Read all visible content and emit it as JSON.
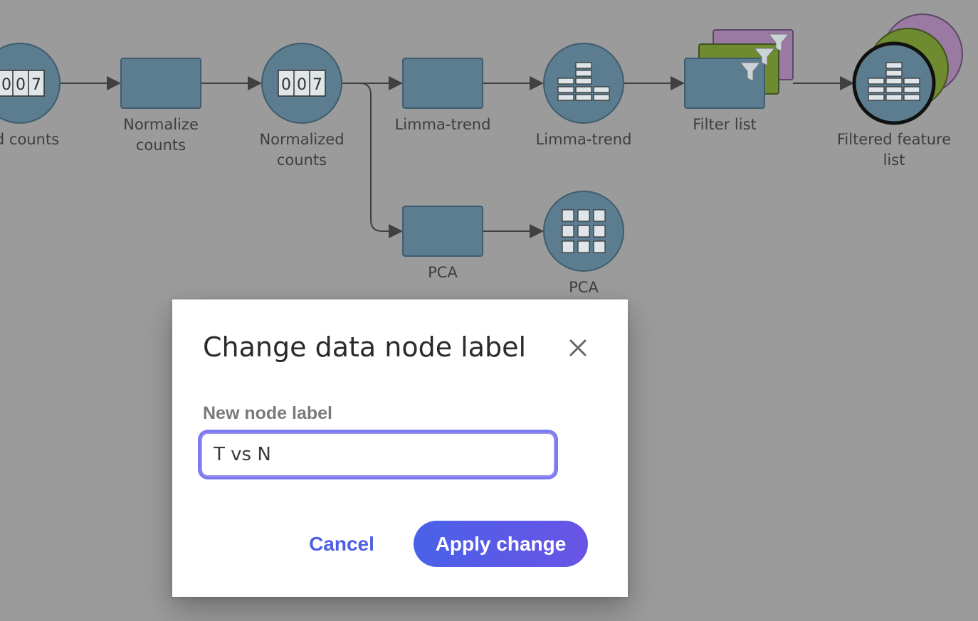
{
  "workflow": {
    "nodes": [
      {
        "id": "n1",
        "label": "ed counts",
        "icon": "counter-icon"
      },
      {
        "id": "n2",
        "label": "Normalize counts",
        "icon": "tool-box"
      },
      {
        "id": "n3",
        "label": "Normalized counts",
        "icon": "counter-icon"
      },
      {
        "id": "n4",
        "label": "Limma-trend",
        "icon": "tool-box"
      },
      {
        "id": "n5",
        "label": "Limma-trend",
        "icon": "table-stack-icon"
      },
      {
        "id": "n6",
        "label": "Filter list",
        "icon": "filter-icon"
      },
      {
        "id": "n7",
        "label": "Filtered feature list",
        "icon": "table-stack-icon"
      },
      {
        "id": "n8",
        "label": "PCA",
        "icon": "tool-box"
      },
      {
        "id": "n9",
        "label": "PCA",
        "icon": "grid-icon"
      }
    ],
    "counter_digits": [
      "0",
      "0",
      "7"
    ]
  },
  "dialog": {
    "title": "Change data node label",
    "field_label": "New node label",
    "input_value": "T vs N",
    "cancel_label": "Cancel",
    "apply_label": "Apply change"
  },
  "colors": {
    "background": "#9b9b9b",
    "node_fill": "#5b7d8f",
    "node_stroke": "#3f5d6d",
    "accent": "#4f5fe3",
    "stack_green": "#6f8b2f",
    "stack_purple": "#9a7aa2"
  }
}
